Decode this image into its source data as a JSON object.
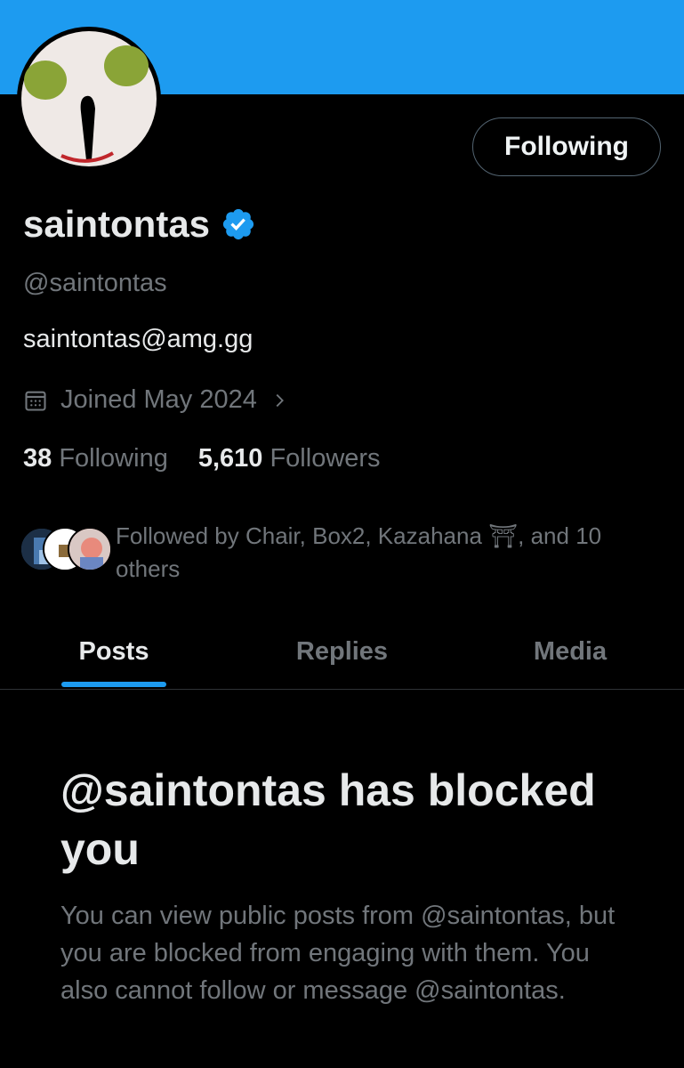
{
  "colors": {
    "banner": "#1d9bf0",
    "accent": "#1d9bf0",
    "background": "#000000",
    "muted": "#71767b"
  },
  "profile": {
    "display_name": "saintontas",
    "verified_icon": "verified-badge-icon",
    "handle": "@saintontas",
    "bio": "saintontas@amg.gg",
    "joined": "Joined May 2024",
    "follow_button": "Following"
  },
  "stats": {
    "following_count": "38",
    "following_label": "Following",
    "followers_count": "5,610",
    "followers_label": "Followers"
  },
  "followed_by": {
    "text": "Followed by Chair, Box2, Kazahana ⛩, and 10 others"
  },
  "tabs": [
    {
      "label": "Posts",
      "active": true
    },
    {
      "label": "Replies",
      "active": false
    },
    {
      "label": "Media",
      "active": false
    }
  ],
  "blocked": {
    "title": "@saintontas has blocked you",
    "body": "You can view public posts from @saintontas, but you are blocked from engaging with them. You also cannot follow or message @saintontas."
  }
}
